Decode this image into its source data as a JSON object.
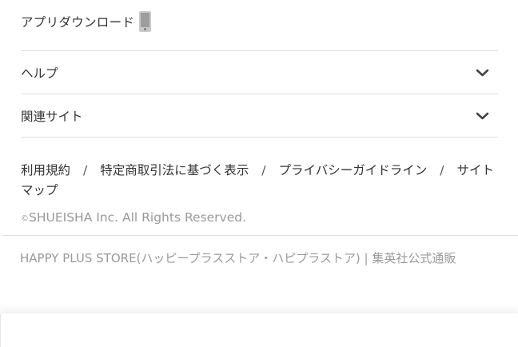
{
  "app_download": {
    "label": "アプリダウンロード",
    "icon": "smartphone-icon"
  },
  "accordions": [
    {
      "label": "ヘルプ",
      "icon": "chevron-down-icon"
    },
    {
      "label": "関連サイト",
      "icon": "chevron-down-icon"
    }
  ],
  "footer_links": [
    "利用規約",
    "特定商取引法に基づく表示",
    "プライバシーガイドライン",
    "サイトマップ"
  ],
  "separator": "/",
  "copyright": {
    "symbol": "©",
    "text": "SHUEISHA Inc. All Rights Reserved."
  },
  "store_name": "HAPPY PLUS STORE(ハッピープラスストア・ハピプラストア) | 集英社公式通販",
  "colors": {
    "text": "#333333",
    "muted": "#9a9a9a",
    "rule": "#dddddd"
  }
}
